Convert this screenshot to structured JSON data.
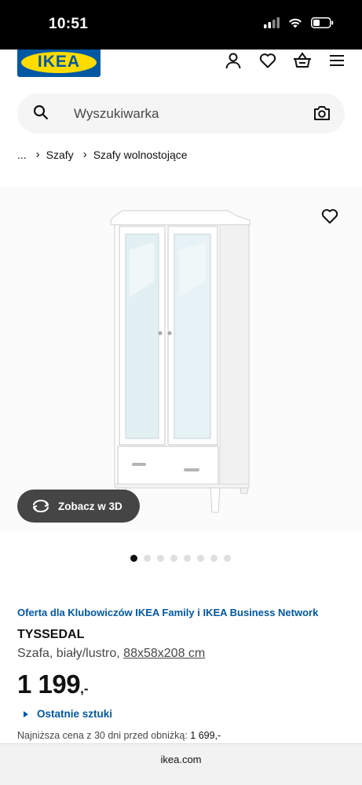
{
  "status_bar": {
    "time": "10:51"
  },
  "brand": {
    "logo_text": "IKEA",
    "primary_color": "#0058a3",
    "accent_color": "#ffdb00"
  },
  "header": {
    "icons": [
      "user-icon",
      "heart-icon",
      "cart-icon",
      "menu-icon"
    ]
  },
  "search": {
    "placeholder": "Wyszukiwarka",
    "icons": [
      "search-icon",
      "camera-icon"
    ]
  },
  "breadcrumb": {
    "items": [
      "...",
      "Szafy",
      "Szafy wolnostojące"
    ]
  },
  "gallery": {
    "view_3d_label": "Zobacz w 3D",
    "dot_count": 8,
    "active_dot": 0
  },
  "product": {
    "offer": "Oferta dla Klubowiczów IKEA Family i IKEA Business Network",
    "name": "TYSSEDAL",
    "description": "Szafa, biały/lustro, ",
    "dimensions": "88x58x208 cm",
    "price_integer": "1 199",
    "price_decimal": ",-",
    "stock_status": "Ostatnie sztuki",
    "lowest_price_label": "Najniższa cena z 30 dni przed obniżką: ",
    "lowest_price_value": "1 699,-"
  },
  "browser": {
    "url": "ikea.com"
  }
}
